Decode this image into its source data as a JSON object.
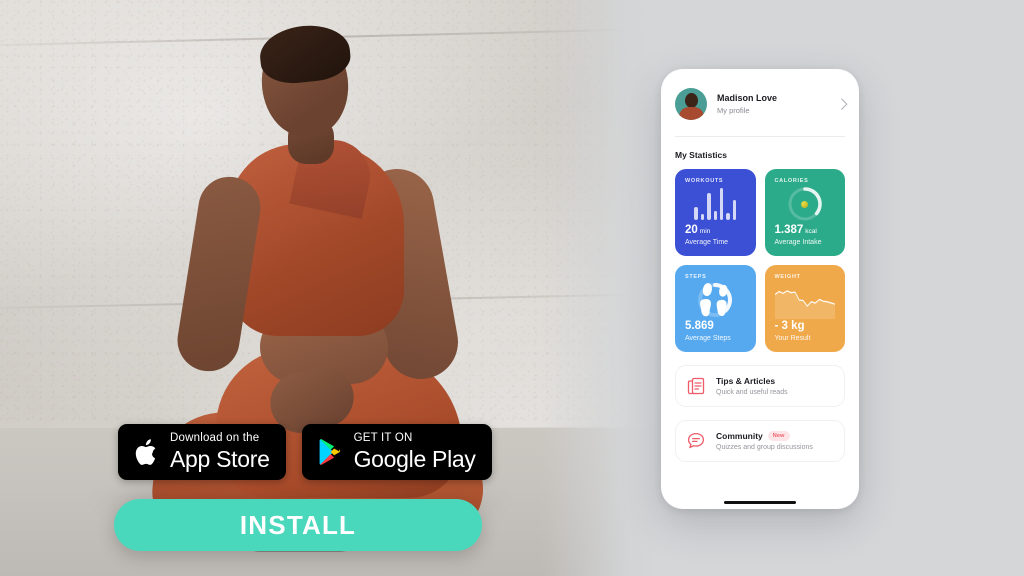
{
  "background_color": "#d4d6d8",
  "hero": {
    "alt": "woman in rust-colored sportswear crouching against concrete wall"
  },
  "cta": {
    "install_label": "INSTALL",
    "install_color": "#4ad8bd",
    "badges": [
      {
        "icon": "apple-icon",
        "small": "Download on the",
        "big": "App Store"
      },
      {
        "icon": "google-play-icon",
        "small": "GET IT ON",
        "big": "Google Play"
      }
    ]
  },
  "phone": {
    "profile": {
      "name": "Madison Love",
      "subtitle": "My profile",
      "chevron": "chevron-right-icon"
    },
    "section_title": "My Statistics",
    "cards": [
      {
        "label": "WORKOUTS",
        "value": "20",
        "unit": "min",
        "desc": "Average Time",
        "color": "#3b50d4",
        "viz": "bar-chart"
      },
      {
        "label": "CALORIES",
        "value": "1.387",
        "unit": "kcal",
        "desc": "Average Intake",
        "color": "#2cab8a",
        "viz": "progress-ring"
      },
      {
        "label": "STEPS",
        "value": "5.869",
        "unit": "",
        "desc": "Average Steps",
        "color": "#56a9ef",
        "viz": "progress-ring-footprints"
      },
      {
        "label": "WEIGHT",
        "value": "- 3 kg",
        "unit": "",
        "desc": "Your Result",
        "color": "#f0a94a",
        "viz": "area-line-chart"
      }
    ],
    "list": [
      {
        "icon": "document-icon",
        "title": "Tips & Articles",
        "subtitle": "Quick and useful reads",
        "badge": ""
      },
      {
        "icon": "chat-bubble-icon",
        "title": "Community",
        "subtitle": "Quizzes and group discussions",
        "badge": "New"
      }
    ]
  },
  "chart_data": [
    {
      "type": "bar",
      "title": "WORKOUTS",
      "categories": [
        "1",
        "2",
        "3",
        "4",
        "5",
        "6",
        "7"
      ],
      "values": [
        40,
        18,
        85,
        30,
        100,
        22,
        62
      ],
      "ylim": [
        0,
        100
      ],
      "grid": false
    },
    {
      "type": "pie",
      "title": "CALORIES",
      "categories": [
        "filled",
        "remaining"
      ],
      "values": [
        32,
        68
      ],
      "grid": false
    },
    {
      "type": "pie",
      "title": "STEPS",
      "categories": [
        "filled",
        "remaining"
      ],
      "values": [
        30,
        70
      ],
      "grid": false
    },
    {
      "type": "area",
      "title": "WEIGHT",
      "x": [
        0,
        1,
        2,
        3,
        4,
        5,
        6,
        7,
        8,
        9,
        10,
        11,
        12,
        13,
        14,
        15
      ],
      "values": [
        68,
        78,
        72,
        80,
        74,
        76,
        50,
        48,
        30,
        44,
        40,
        52,
        46,
        44,
        40,
        36
      ],
      "ylim": [
        0,
        100
      ],
      "grid": false
    }
  ]
}
